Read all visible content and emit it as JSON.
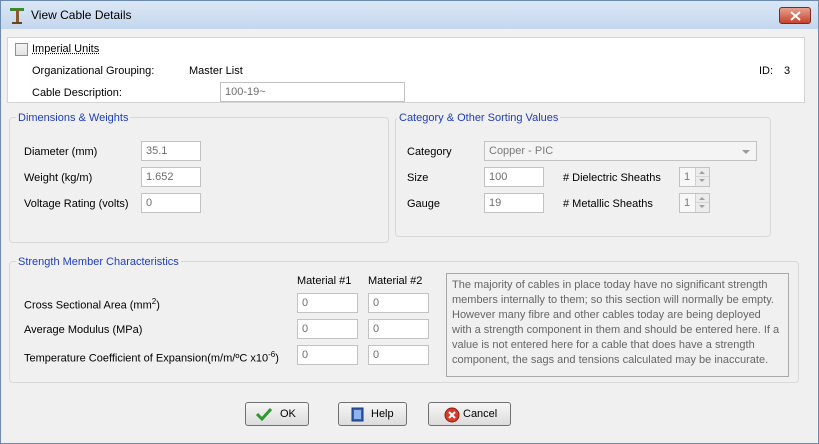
{
  "window": {
    "title": "View Cable Details",
    "close_glyph": "×"
  },
  "header": {
    "imperial_units_label": "Imperial Units",
    "imperial_units_checked": false,
    "org_grouping_label": "Organizational Grouping:",
    "org_grouping_value": "Master List",
    "id_label": "ID:",
    "id_value": "3",
    "cable_description_label": "Cable Description:",
    "cable_description_value": "100-19~"
  },
  "dimensions": {
    "title": "Dimensions & Weights",
    "diameter_label": "Diameter (mm)",
    "diameter_value": "35.1",
    "weight_label": "Weight (kg/m)",
    "weight_value": "1.652",
    "voltage_label": "Voltage Rating (volts)",
    "voltage_value": "0"
  },
  "category": {
    "title": "Category & Other Sorting Values",
    "category_label": "Category",
    "category_value": "Copper - PIC",
    "size_label": "Size",
    "size_value": "100",
    "gauge_label": "Gauge",
    "gauge_value": "19",
    "dielectric_label": "# Dielectric Sheaths",
    "dielectric_value": "1",
    "metallic_label": "# Metallic Sheaths",
    "metallic_value": "1"
  },
  "strength": {
    "title": "Strength Member Characteristics",
    "material1_header": "Material #1",
    "material2_header": "Material #2",
    "cross_section_label": "Cross Sectional Area (mm",
    "cross_section_sup": "2",
    "cross_section_close": ")",
    "cross_section_m1": "0",
    "cross_section_m2": "0",
    "modulus_label": "Average Modulus (MPa)",
    "modulus_m1": "0",
    "modulus_m2": "0",
    "temp_coeff_label": "Temperature Coefficient of Expansion(m/m/ºC x10",
    "temp_coeff_sup": "-6",
    "temp_coeff_close": ")",
    "temp_coeff_m1": "0",
    "temp_coeff_m2": "0",
    "note": "The majority of cables in place today have no significant strength members internally to them; so this section will normally be empty. However many fibre and other cables today are being deployed with a strength component in them and should be entered here. If a value is not entered here for a cable that does have a strength component, the sags and tensions calculated may be inaccurate."
  },
  "buttons": {
    "ok": "OK",
    "help": "Help",
    "cancel": "Cancel"
  },
  "colors": {
    "group_title": "#1f3dbf",
    "ok_check": "#2e9a2e",
    "cancel_red": "#d83a2a"
  },
  "icons": [
    "pole-icon",
    "close-icon",
    "checkmark-icon",
    "help-book-icon",
    "cancel-icon"
  ]
}
